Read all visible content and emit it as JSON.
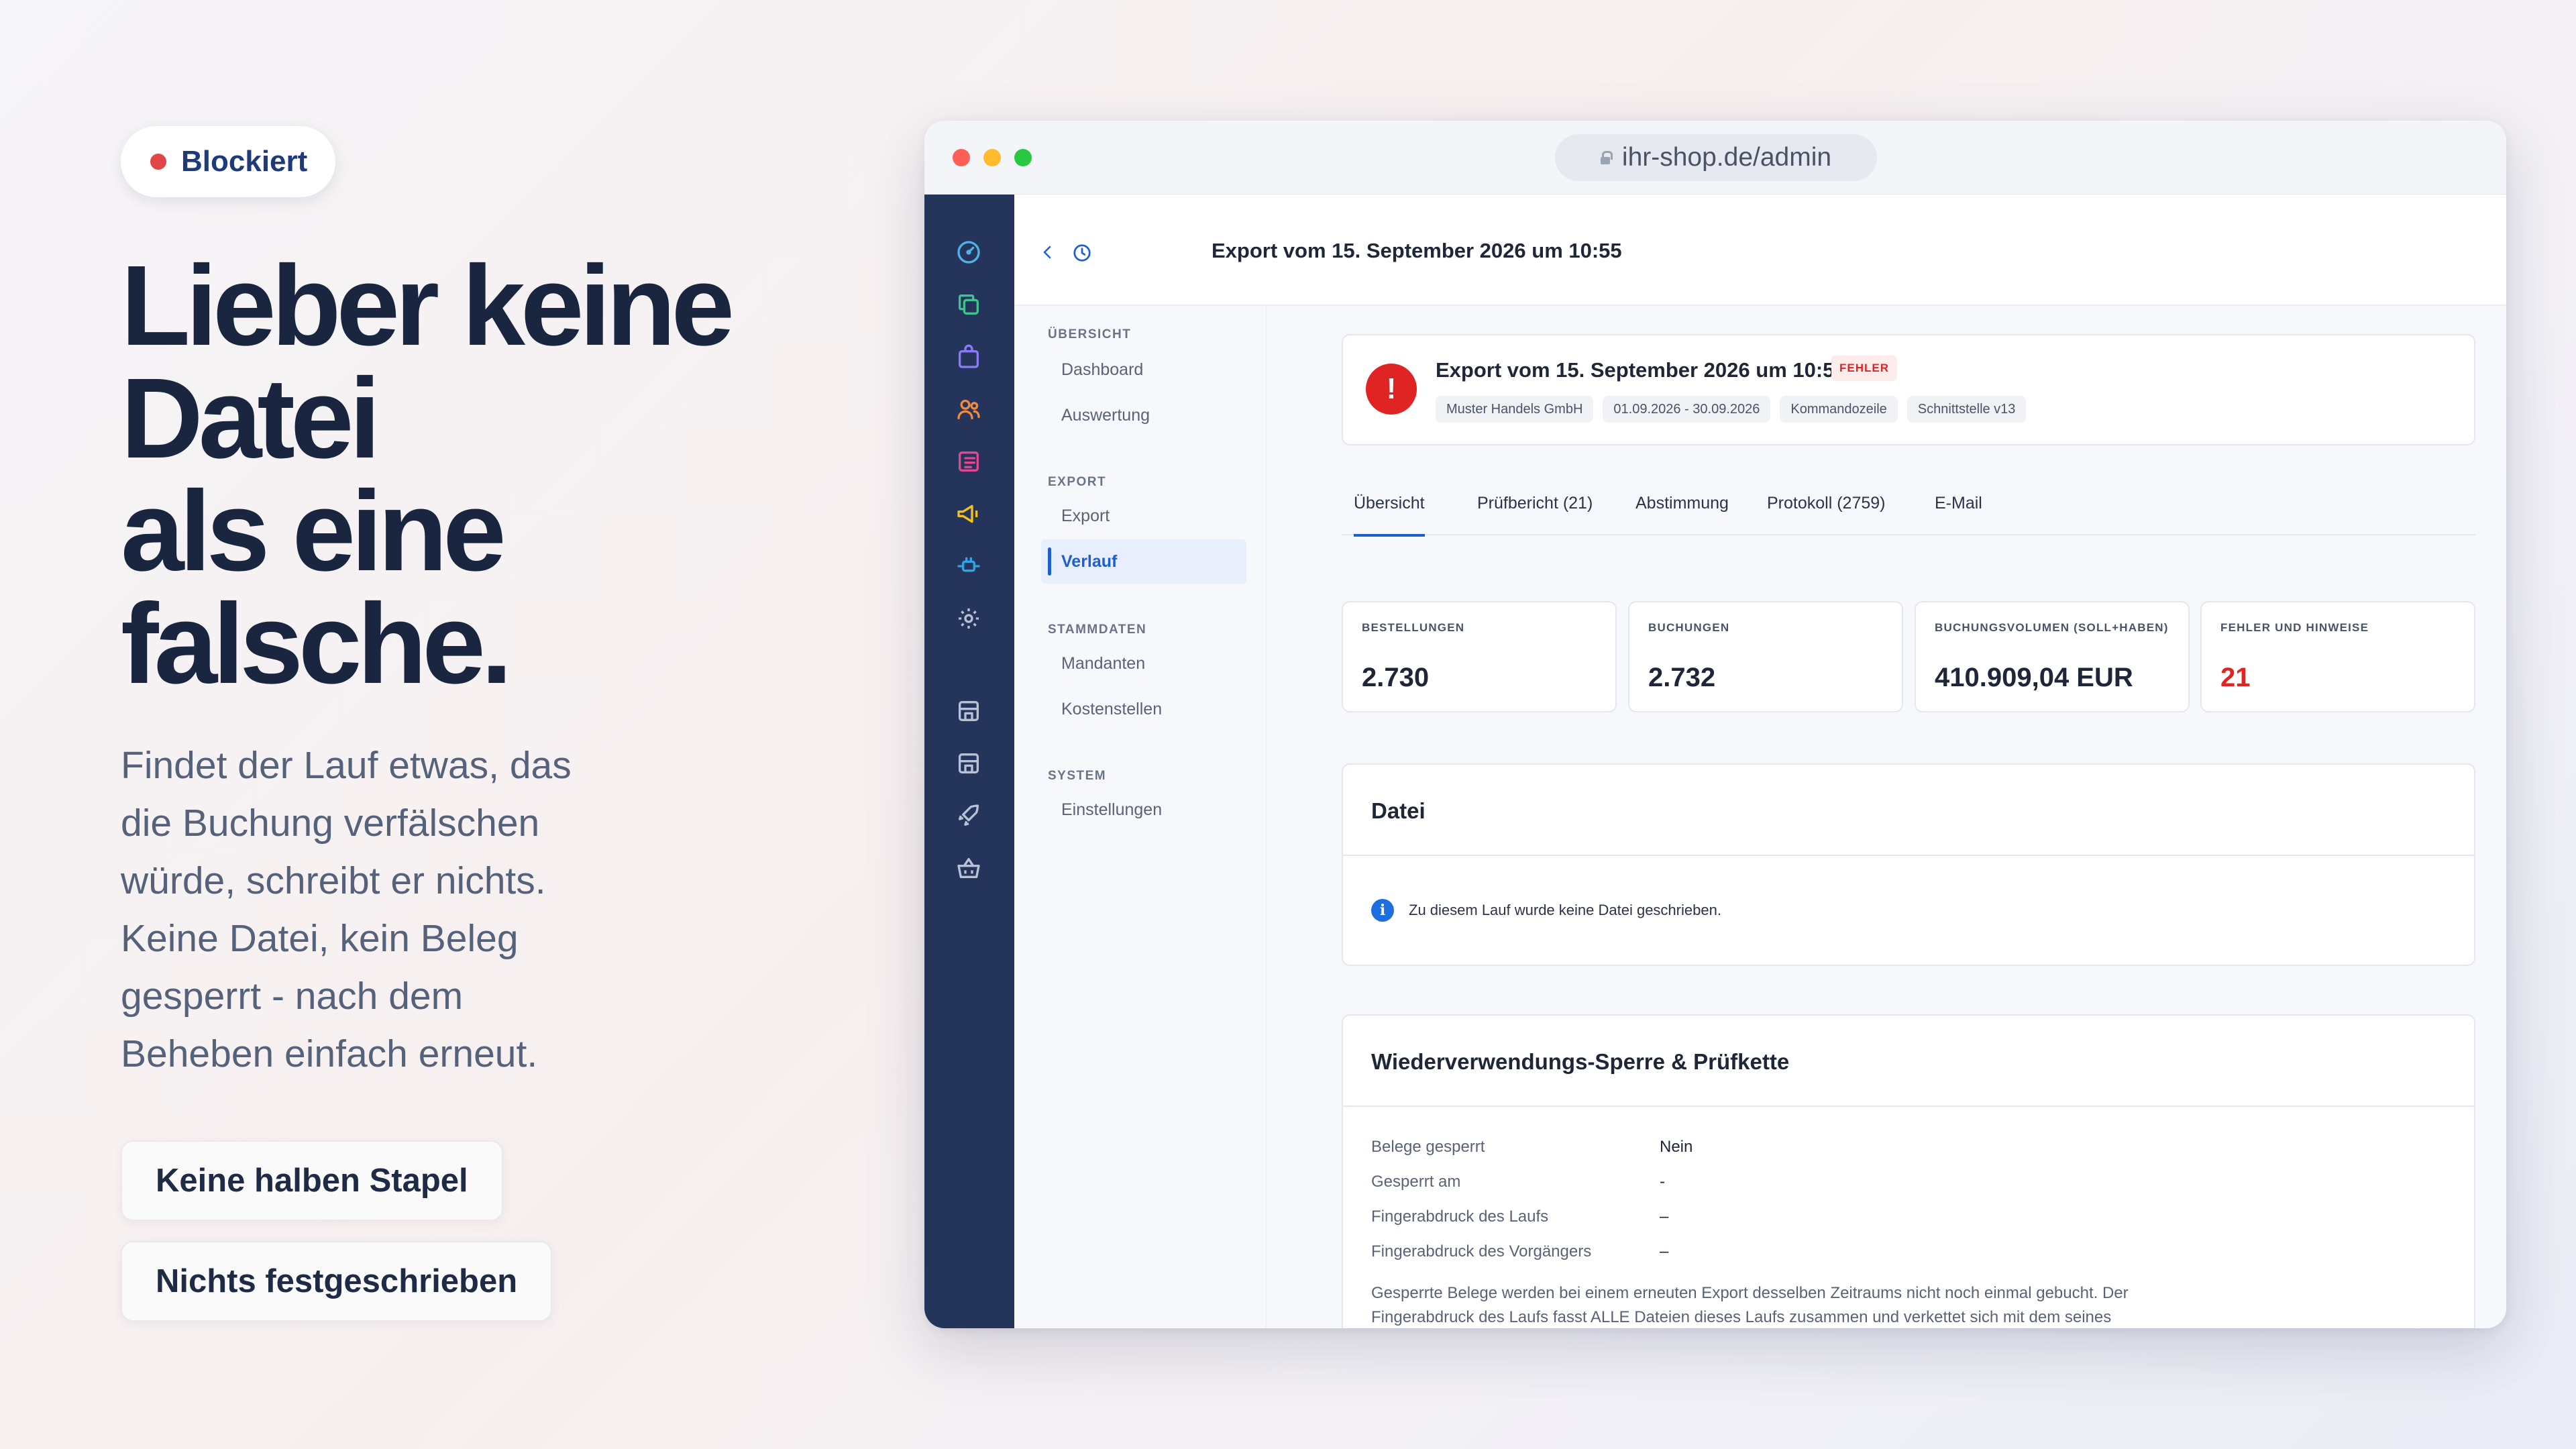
{
  "hero": {
    "badge": "Blockiert",
    "headline": [
      "Lieber keine",
      "Datei",
      "als eine",
      "falsche."
    ],
    "body": [
      "Findet der Lauf etwas, das",
      "die Buchung verfälschen",
      "würde, schreibt er nichts.",
      "Keine Datei, kein Beleg",
      "gesperrt - nach dem",
      "Beheben einfach erneut."
    ],
    "pills": [
      "Keine halben Stapel",
      "Nichts festgeschrieben"
    ]
  },
  "browser": {
    "url": "ihr-shop.de/admin"
  },
  "rail_icons": [
    "dashboard-icon",
    "copy-icon",
    "shopping-bag-icon",
    "users-icon",
    "list-icon",
    "megaphone-icon",
    "plugin-icon",
    "gear-icon",
    "store-icon",
    "store-icon",
    "rocket-icon",
    "basket-icon"
  ],
  "page": {
    "title": "Export vom 15. September 2026 um 10:55"
  },
  "subnav": {
    "sections": [
      {
        "label": "ÜBERSICHT",
        "items": [
          "Dashboard",
          "Auswertung"
        ]
      },
      {
        "label": "EXPORT",
        "items": [
          "Export",
          "Verlauf"
        ]
      },
      {
        "label": "STAMMDATEN",
        "items": [
          "Mandanten",
          "Kostenstellen"
        ]
      },
      {
        "label": "SYSTEM",
        "items": [
          "Einstellungen"
        ]
      }
    ],
    "active": "Verlauf"
  },
  "export": {
    "title": "Export vom 15. September 2026 um 10:55",
    "status": "FEHLER",
    "chips": [
      "Muster Handels GmbH",
      "01.09.2026 - 30.09.2026",
      "Kommandozeile",
      "Schnittstelle v13"
    ]
  },
  "tabs": [
    "Übersicht",
    "Prüfbericht (21)",
    "Abstimmung",
    "Protokoll (2759)",
    "E-Mail"
  ],
  "stats": [
    {
      "label": "BESTELLUNGEN",
      "value": "2.730"
    },
    {
      "label": "BUCHUNGEN",
      "value": "2.732"
    },
    {
      "label": "BUCHUNGSVOLUMEN (SOLL+HABEN)",
      "value": "410.909,04 EUR"
    },
    {
      "label": "FEHLER UND HINWEISE",
      "value": "21"
    }
  ],
  "file_card": {
    "title": "Datei",
    "info": "Zu diesem Lauf wurde keine Datei geschrieben."
  },
  "lock_card": {
    "title": "Wiederverwendungs-Sperre & Prüfkette",
    "rows": [
      {
        "key": "Belege gesperrt",
        "value": "Nein"
      },
      {
        "key": "Gesperrt am",
        "value": "-"
      },
      {
        "key": "Fingerabdruck des Laufs",
        "value": "–"
      },
      {
        "key": "Fingerabdruck des Vorgängers",
        "value": "–"
      }
    ],
    "note": [
      "Gesperrte Belege werden bei einem erneuten Export desselben Zeitraums nicht noch einmal gebucht. Der",
      "Fingerabdruck des Laufs fasst ALLE Dateien dieses Laufs zusammen und verkettet sich mit dem seines"
    ]
  },
  "colors": {
    "accent": "#1d5fd0",
    "error": "#e02424",
    "rail": "#24345a",
    "headline": "#1a2540"
  }
}
